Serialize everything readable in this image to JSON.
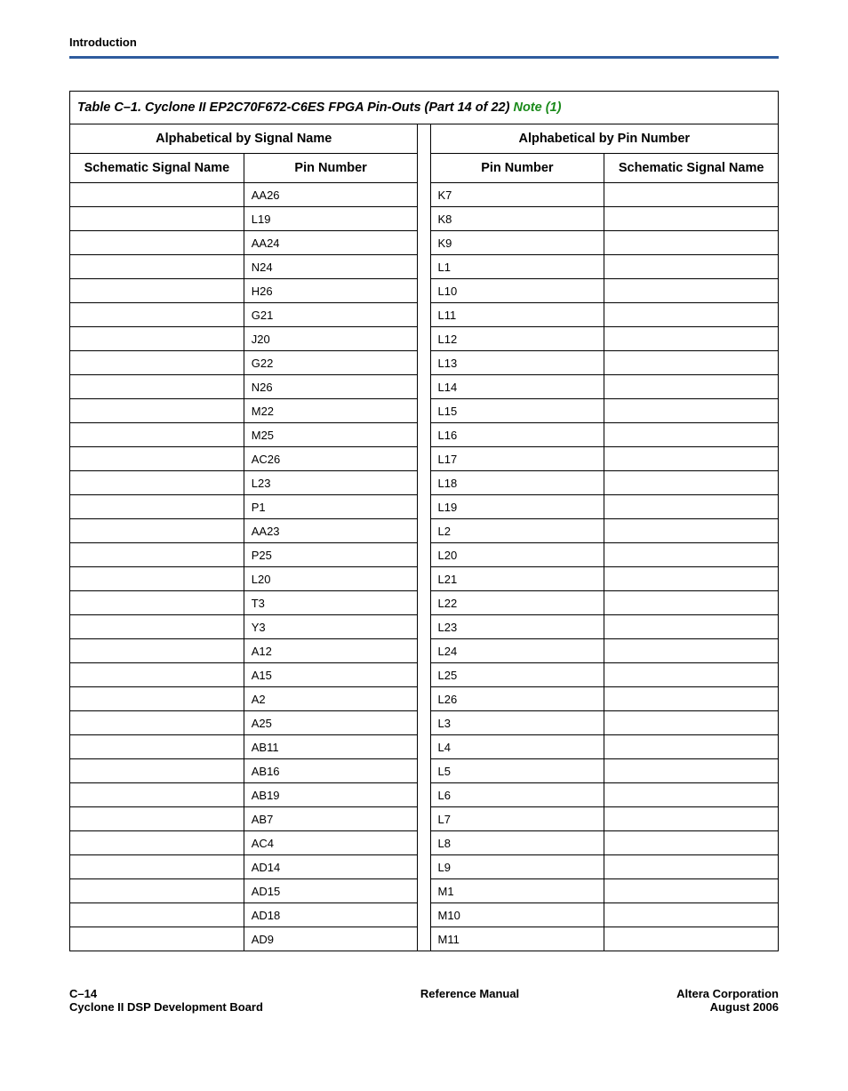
{
  "header": {
    "section": "Introduction"
  },
  "table": {
    "caption_prefix": "Table C–1. Cyclone II EP2C70F672-C6ES FPGA Pin-Outs  (Part 14 of 22) ",
    "note_text": "Note (1)",
    "group_headers": {
      "left": "Alphabetical by Signal Name",
      "right": "Alphabetical by Pin Number"
    },
    "col_headers": {
      "left_a": "Schematic Signal Name",
      "left_b": "Pin Number",
      "right_a": "Pin Number",
      "right_b": "Schematic Signal Name"
    },
    "rows": [
      {
        "l_sig": "",
        "l_pin": "AA26",
        "r_pin": "K7",
        "r_sig": ""
      },
      {
        "l_sig": "",
        "l_pin": "L19",
        "r_pin": "K8",
        "r_sig": ""
      },
      {
        "l_sig": "",
        "l_pin": "AA24",
        "r_pin": "K9",
        "r_sig": ""
      },
      {
        "l_sig": "",
        "l_pin": "N24",
        "r_pin": "L1",
        "r_sig": ""
      },
      {
        "l_sig": "",
        "l_pin": "H26",
        "r_pin": "L10",
        "r_sig": ""
      },
      {
        "l_sig": "",
        "l_pin": "G21",
        "r_pin": "L11",
        "r_sig": ""
      },
      {
        "l_sig": "",
        "l_pin": "J20",
        "r_pin": "L12",
        "r_sig": ""
      },
      {
        "l_sig": "",
        "l_pin": "G22",
        "r_pin": "L13",
        "r_sig": ""
      },
      {
        "l_sig": "",
        "l_pin": "N26",
        "r_pin": "L14",
        "r_sig": ""
      },
      {
        "l_sig": "",
        "l_pin": "M22",
        "r_pin": "L15",
        "r_sig": ""
      },
      {
        "l_sig": "",
        "l_pin": "M25",
        "r_pin": "L16",
        "r_sig": ""
      },
      {
        "l_sig": "",
        "l_pin": "AC26",
        "r_pin": "L17",
        "r_sig": ""
      },
      {
        "l_sig": "",
        "l_pin": "L23",
        "r_pin": "L18",
        "r_sig": ""
      },
      {
        "l_sig": "",
        "l_pin": "P1",
        "r_pin": "L19",
        "r_sig": ""
      },
      {
        "l_sig": "",
        "l_pin": "AA23",
        "r_pin": "L2",
        "r_sig": ""
      },
      {
        "l_sig": "",
        "l_pin": "P25",
        "r_pin": "L20",
        "r_sig": ""
      },
      {
        "l_sig": "",
        "l_pin": "L20",
        "r_pin": "L21",
        "r_sig": ""
      },
      {
        "l_sig": "",
        "l_pin": "T3",
        "r_pin": "L22",
        "r_sig": ""
      },
      {
        "l_sig": "",
        "l_pin": "Y3",
        "r_pin": "L23",
        "r_sig": ""
      },
      {
        "l_sig": "",
        "l_pin": "A12",
        "r_pin": "L24",
        "r_sig": ""
      },
      {
        "l_sig": "",
        "l_pin": "A15",
        "r_pin": "L25",
        "r_sig": ""
      },
      {
        "l_sig": "",
        "l_pin": "A2",
        "r_pin": "L26",
        "r_sig": ""
      },
      {
        "l_sig": "",
        "l_pin": "A25",
        "r_pin": "L3",
        "r_sig": ""
      },
      {
        "l_sig": "",
        "l_pin": "AB11",
        "r_pin": "L4",
        "r_sig": ""
      },
      {
        "l_sig": "",
        "l_pin": "AB16",
        "r_pin": "L5",
        "r_sig": ""
      },
      {
        "l_sig": "",
        "l_pin": "AB19",
        "r_pin": "L6",
        "r_sig": ""
      },
      {
        "l_sig": "",
        "l_pin": "AB7",
        "r_pin": "L7",
        "r_sig": ""
      },
      {
        "l_sig": "",
        "l_pin": "AC4",
        "r_pin": "L8",
        "r_sig": ""
      },
      {
        "l_sig": "",
        "l_pin": "AD14",
        "r_pin": "L9",
        "r_sig": ""
      },
      {
        "l_sig": "",
        "l_pin": "AD15",
        "r_pin": "M1",
        "r_sig": ""
      },
      {
        "l_sig": "",
        "l_pin": "AD18",
        "r_pin": "M10",
        "r_sig": ""
      },
      {
        "l_sig": "",
        "l_pin": "AD9",
        "r_pin": "M11",
        "r_sig": ""
      }
    ]
  },
  "footer": {
    "page_num": "C–14",
    "board": "Cyclone II DSP Development Board",
    "center": "Reference Manual",
    "company": "Altera Corporation",
    "date": "August 2006"
  }
}
